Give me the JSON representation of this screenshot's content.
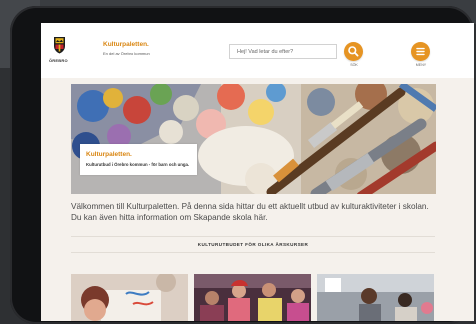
{
  "header": {
    "municipality_label": "ÖREBRO",
    "brand_name": "Kulturpaletten.",
    "brand_subtitle": "En del av Örebro kommun",
    "search_placeholder": "Hej! Vad letar du efter?",
    "search_button_label": "SÖK",
    "menu_button_label": "MENY",
    "accent_color": "#e69423",
    "search_icon": "search-icon",
    "menu_icon": "menu-icon"
  },
  "hero": {
    "title": "Kulturpaletten.",
    "subtitle": "Kulturutbud i Örebro kommun - för barn och unga.",
    "image": "paint-brushes-on-palette"
  },
  "intro": {
    "text": "Välkommen till Kulturpaletten. På denna sida hittar du ett aktuellt utbud av kulturaktiviteter i skolan. Du kan även hitta information om Skapande skola här."
  },
  "section": {
    "heading": "KULTURUTBUDET FÖR OLIKA ÅRSKURSER"
  },
  "cards": [
    {
      "image": "child-painting-photo"
    },
    {
      "image": "children-group-photo"
    },
    {
      "image": "classroom-photo"
    }
  ]
}
